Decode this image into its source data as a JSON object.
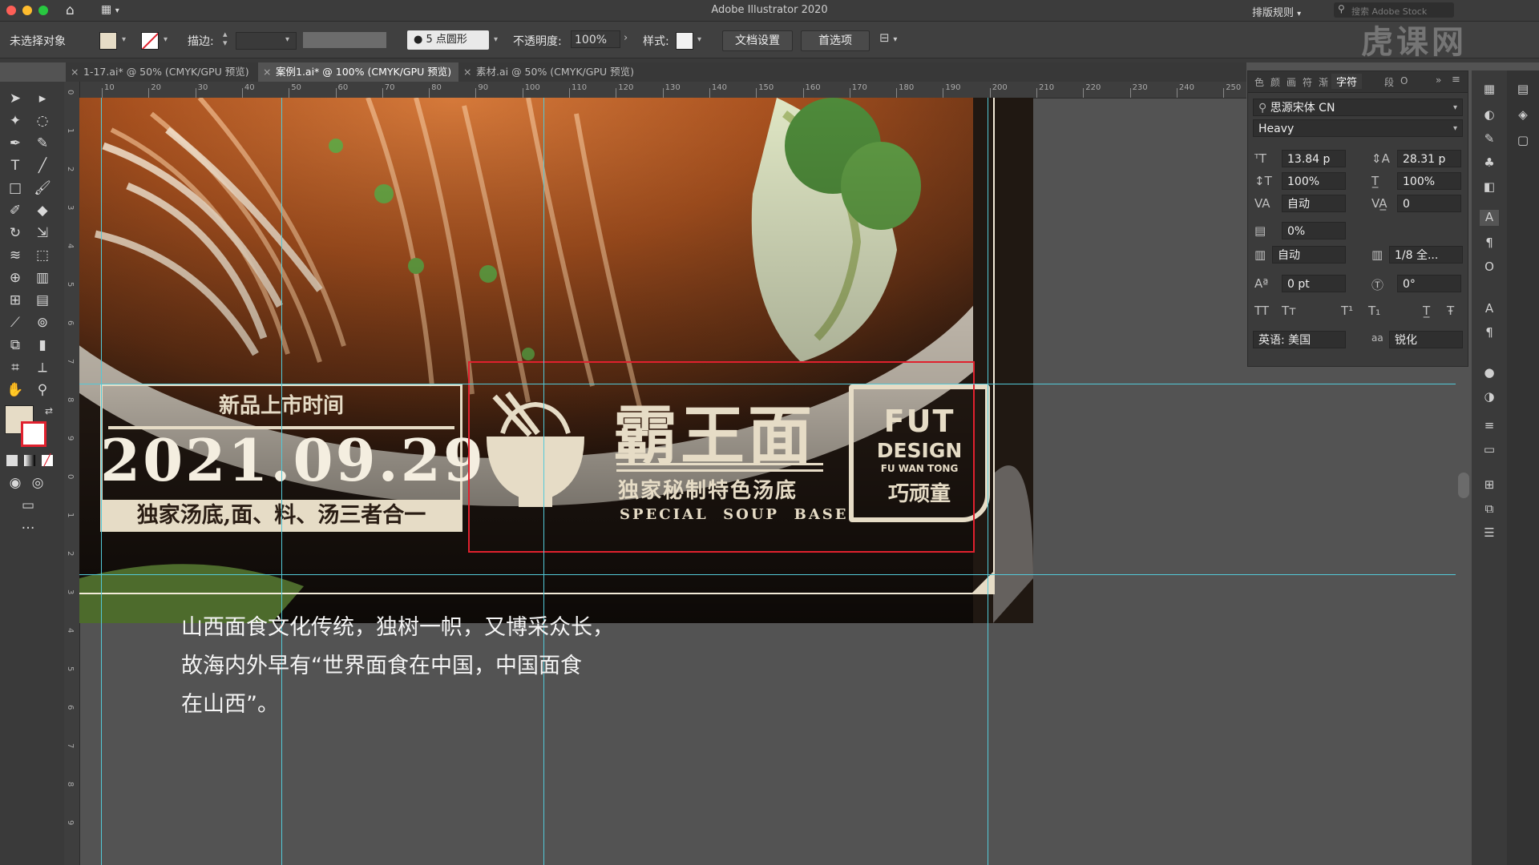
{
  "window": {
    "title": "Adobe Illustrator 2020",
    "workspace": "排版规则",
    "search_placeholder": "搜索 Adobe Stock"
  },
  "control_bar": {
    "selection": "未选择对象",
    "stroke_label": "描边:",
    "brush_profile": "5 点圆形",
    "opacity_label": "不透明度:",
    "opacity_value": "100%",
    "style_label": "样式:",
    "doc_setup_button": "文档设置",
    "preferences_button": "首选项"
  },
  "tabs": [
    {
      "label": "1-17.ai* @ 50% (CMYK/GPU 预览)",
      "active": false
    },
    {
      "label": "案例1.ai* @ 100% (CMYK/GPU 预览)",
      "active": true
    },
    {
      "label": "素材.ai @ 50% (CMYK/GPU 预览)",
      "active": false
    }
  ],
  "ruler": {
    "h_ticks": [
      "10",
      "20",
      "30",
      "40",
      "50",
      "60",
      "70",
      "80",
      "90",
      "100",
      "110",
      "120",
      "130",
      "140",
      "150",
      "160",
      "170",
      "180",
      "190",
      "200",
      "210",
      "220",
      "230",
      "240",
      "250"
    ],
    "v_ticks": [
      "0",
      "1",
      "2",
      "3",
      "4",
      "5",
      "6",
      "7",
      "8",
      "9",
      "0",
      "1",
      "2",
      "3",
      "4",
      "5",
      "6",
      "7",
      "8",
      "9"
    ]
  },
  "artwork": {
    "new_product_label": "新品上市时间",
    "date": "2021.09.29",
    "tagline": "独家汤底,面、料、汤三者合一",
    "brand_name": "霸王面",
    "brand_sub": "独家秘制特色汤底",
    "brand_en": "SPECIAL  SOUP  BASE",
    "logo_top": "FUT",
    "logo_design": "DESIGN",
    "logo_small": "FU WAN TONG",
    "logo_bottom": "巧顽童",
    "body_lines": [
      "山西面食文化传统，独树一帜，又博采众长，",
      "故海内外早有“世界面食在中国，中国面食",
      "在山西”。"
    ]
  },
  "character_panel": {
    "tabs": [
      "色",
      "颜",
      "画",
      "符",
      "渐",
      "字符",
      "段",
      "O"
    ],
    "active_tab": "字符",
    "font_family": "思源宋体 CN",
    "font_style": "Heavy",
    "font_size": "13.84 p",
    "leading": "28.31 p",
    "vertical_scale": "100%",
    "horizontal_scale": "100%",
    "kerning": "自动",
    "tracking": "0",
    "tsume": "0%",
    "aki_left": "自动",
    "aki_right": "1/8 全...",
    "baseline_shift": "0 pt",
    "rotation": "0°",
    "language": "英语: 美国",
    "antialias_label": "aa",
    "antialias": "锐化"
  },
  "colors": {
    "accent_red": "#e0212e",
    "guide": "#53c9d8",
    "cream": "#e6dcc6",
    "panel_bg": "#3b3b3b"
  },
  "watermark": "虎课网"
}
